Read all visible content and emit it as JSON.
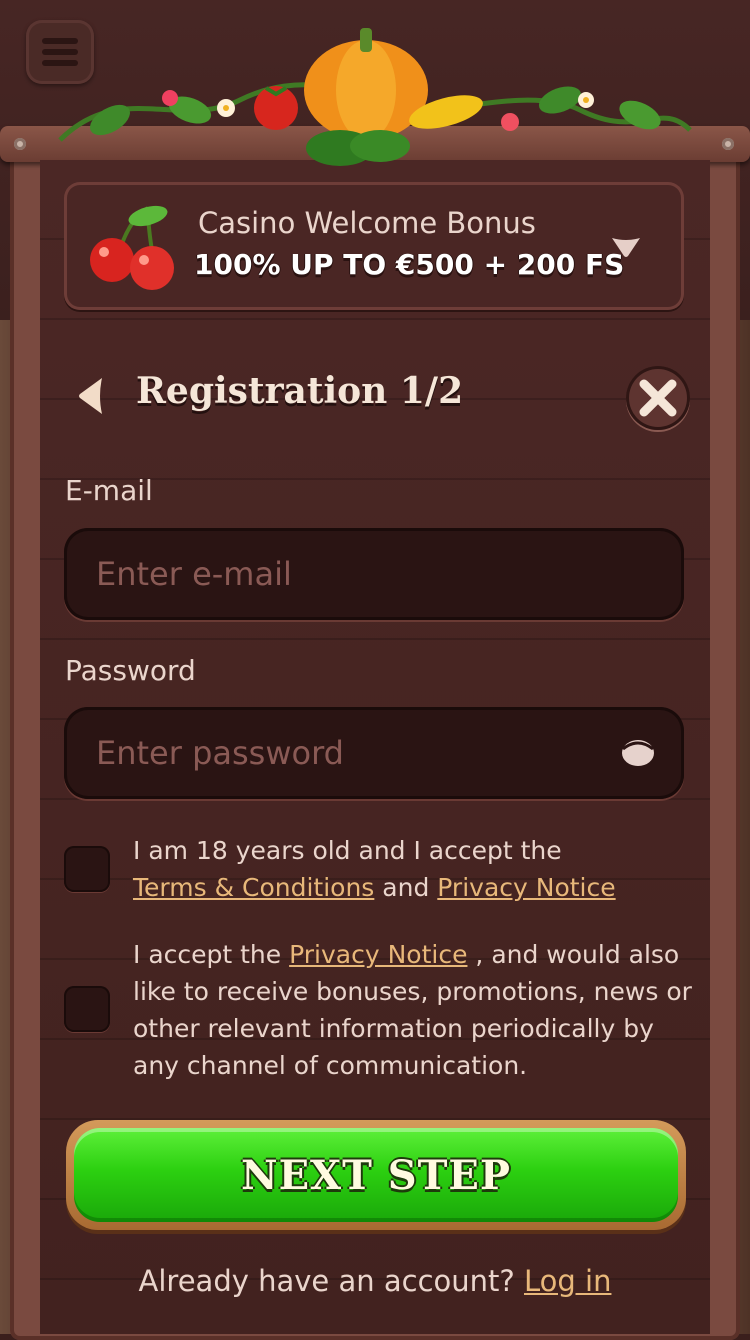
{
  "bonus": {
    "title": "Casino Welcome Bonus",
    "offer": "100% UP TO €500 + 200 FS"
  },
  "header": {
    "title": "Registration 1/2"
  },
  "form": {
    "email_label": "E-mail",
    "email_placeholder": "Enter e-mail",
    "password_label": "Password",
    "password_placeholder": "Enter password"
  },
  "consent_terms": {
    "text_before": "I am 18 years old and I accept the",
    "terms_link": "Terms & Conditions",
    "and": "and",
    "privacy_link": "Privacy Notice"
  },
  "consent_marketing": {
    "text_before": "I accept the",
    "privacy_link": "Privacy Notice",
    "text_after": ", and would also like to receive bonuses, promotions, news or other relevant information periodically by any channel of communication."
  },
  "next_button": "NEXT STEP",
  "login": {
    "prompt": "Already have an account?",
    "link": "Log in"
  },
  "colors": {
    "panel": "#42221f",
    "accent_green": "#2cd010",
    "link": "#e8b87a"
  }
}
